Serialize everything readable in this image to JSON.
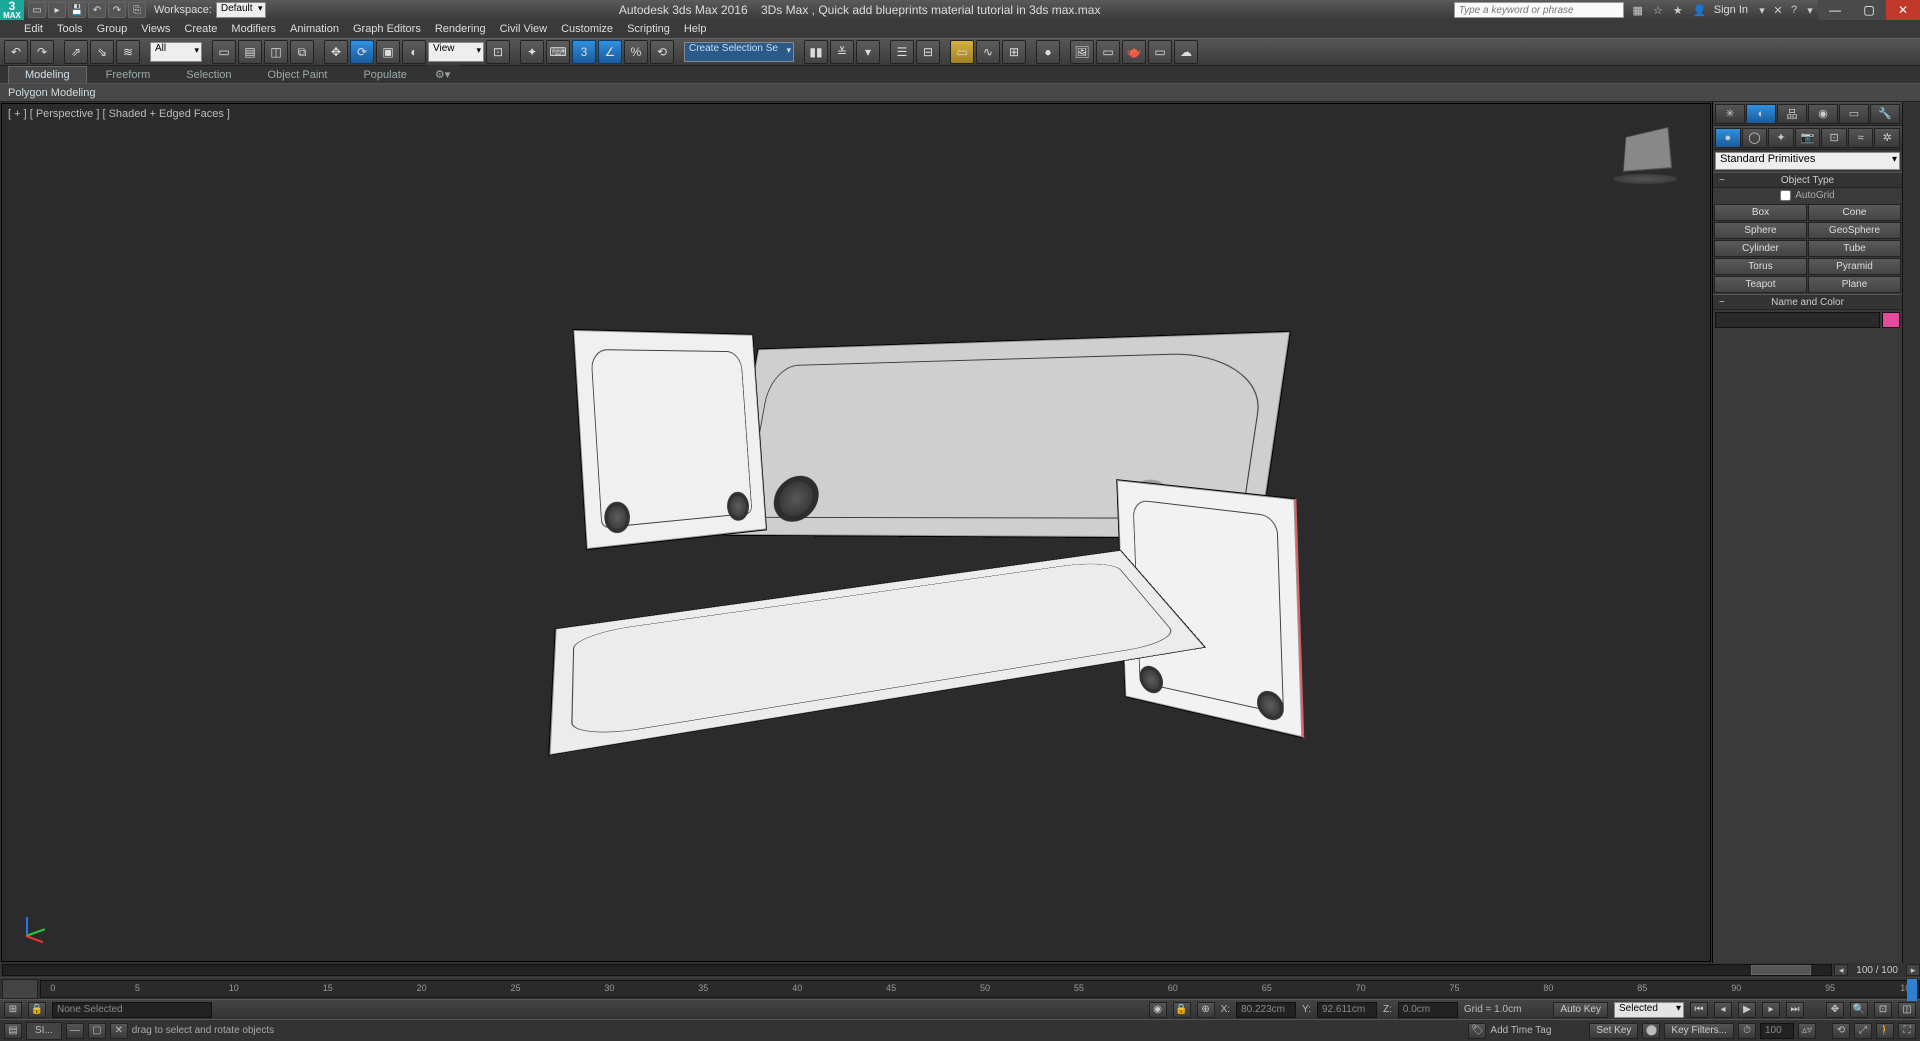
{
  "title": {
    "app": "Autodesk 3ds Max 2016",
    "file": "3Ds Max , Quick add blueprints material tutorial in 3ds max.max",
    "workspace_label": "Workspace:",
    "workspace_value": "Default",
    "search_placeholder": "Type a keyword or phrase",
    "signin": "Sign In"
  },
  "menu": [
    "Edit",
    "Tools",
    "Group",
    "Views",
    "Create",
    "Modifiers",
    "Animation",
    "Graph Editors",
    "Rendering",
    "Civil View",
    "Customize",
    "Scripting",
    "Help"
  ],
  "toolbar": {
    "filter_dd": "All",
    "view_dd": "View",
    "selset_dd": "Create Selection Se"
  },
  "ribbon": {
    "tabs": [
      "Modeling",
      "Freeform",
      "Selection",
      "Object Paint",
      "Populate"
    ],
    "sub": "Polygon Modeling"
  },
  "viewport": {
    "label": "[ + ] [ Perspective ] [ Shaded + Edged Faces ]"
  },
  "cmdpanel": {
    "category_dd": "Standard Primitives",
    "rollout_type": "Object Type",
    "autogrid": "AutoGrid",
    "prims": [
      "Box",
      "Cone",
      "Sphere",
      "GeoSphere",
      "Cylinder",
      "Tube",
      "Torus",
      "Pyramid",
      "Teapot",
      "Plane"
    ],
    "rollout_name": "Name and Color"
  },
  "hscroll": {
    "frame_label": "100 / 100"
  },
  "timeline": {
    "ticks": [
      "0",
      "5",
      "10",
      "15",
      "20",
      "25",
      "30",
      "35",
      "40",
      "45",
      "50",
      "55",
      "60",
      "65",
      "70",
      "75",
      "80",
      "85",
      "90",
      "95",
      "100"
    ]
  },
  "status": {
    "selection": "None Selected",
    "x_label": "X:",
    "x_val": "80.223cm",
    "y_label": "Y:",
    "y_val": "92.611cm",
    "z_label": "Z:",
    "z_val": "0.0cm",
    "grid": "Grid = 1.0cm",
    "addtag": "Add Time Tag",
    "autokey": "Auto Key",
    "setkey": "Set Key",
    "selected_dd": "Selected",
    "keyfilters": "Key Filters...",
    "frame_spin": "100"
  },
  "taskbar": {
    "app_btn": "SI...",
    "prompt": "drag to select and rotate objects"
  }
}
